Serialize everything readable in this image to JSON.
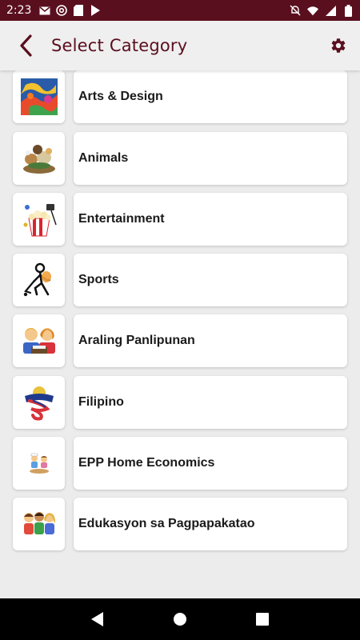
{
  "status_bar": {
    "time": "2:23",
    "left_icons": [
      "gmail-icon",
      "at-sign-icon",
      "sd-card-icon",
      "play-store-icon"
    ],
    "right_icons": [
      "mute-bell-icon",
      "wifi-icon",
      "signal-icon",
      "battery-icon"
    ]
  },
  "app_bar": {
    "title": "Select Category",
    "back_icon": "chevron-left-icon",
    "settings_icon": "gear-icon"
  },
  "colors": {
    "brand": "#5a0f1e",
    "background": "#ececec",
    "card": "#ffffff"
  },
  "categories": [
    {
      "label": "Arts & Design",
      "icon": "paint-palette-icon"
    },
    {
      "label": "Animals",
      "icon": "animals-icon"
    },
    {
      "label": "Entertainment",
      "icon": "popcorn-icon"
    },
    {
      "label": "Sports",
      "icon": "hockey-player-icon"
    },
    {
      "label": "Araling Panlipunan",
      "icon": "students-reading-icon"
    },
    {
      "label": "Filipino",
      "icon": "filipino-banner-icon"
    },
    {
      "label": "EPP Home Economics",
      "icon": "cooking-kids-icon"
    },
    {
      "label": "Edukasyon sa Pagpapakatao",
      "icon": "children-group-icon"
    }
  ],
  "nav_bar": {
    "icons": [
      "back-triangle-icon",
      "home-circle-icon",
      "recents-square-icon"
    ]
  }
}
